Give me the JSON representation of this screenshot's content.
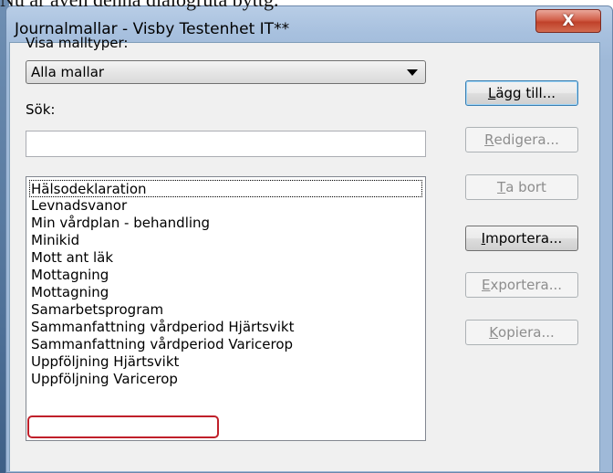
{
  "caption": "Nu är även denna dialogruta byttg.",
  "window": {
    "title": "Journalmallar - Visby Testenhet  IT**"
  },
  "icons": {
    "close": "close-icon"
  },
  "close_glyph": "X",
  "visa_label": "Visa malltyper:",
  "malltyp": {
    "selected": "Alla mallar"
  },
  "sok_label": "Sök:",
  "search": {
    "value": ""
  },
  "buttons": {
    "lagg_till": {
      "acc": "L",
      "rest": "ägg till..."
    },
    "redigera": {
      "acc": "R",
      "rest": "edigera..."
    },
    "ta_bort": {
      "acc": "T",
      "rest": "a bort"
    },
    "importera": {
      "acc": "I",
      "rest": "mportera..."
    },
    "exportera": {
      "acc": "E",
      "rest": "xportera..."
    },
    "kopiera": {
      "acc": "K",
      "rest": "opiera..."
    }
  },
  "list": {
    "items": [
      "Hälsodeklaration",
      "Levnadsvanor",
      "Min vårdplan - behandling",
      "Minikid",
      "Mott ant läk",
      "Mottagning",
      "Mottagning",
      "Samarbetsprogram",
      "Sammanfattning vårdperiod Hjärtsvikt",
      "Sammanfattning vårdperiod Varicerop",
      "Uppföljning Hjärtsvikt",
      "Uppföljning Varicerop"
    ],
    "focused_index": 0,
    "highlighted_index": 10
  },
  "colors": {
    "highlight": "#c0202a",
    "close": "#c0412a"
  }
}
